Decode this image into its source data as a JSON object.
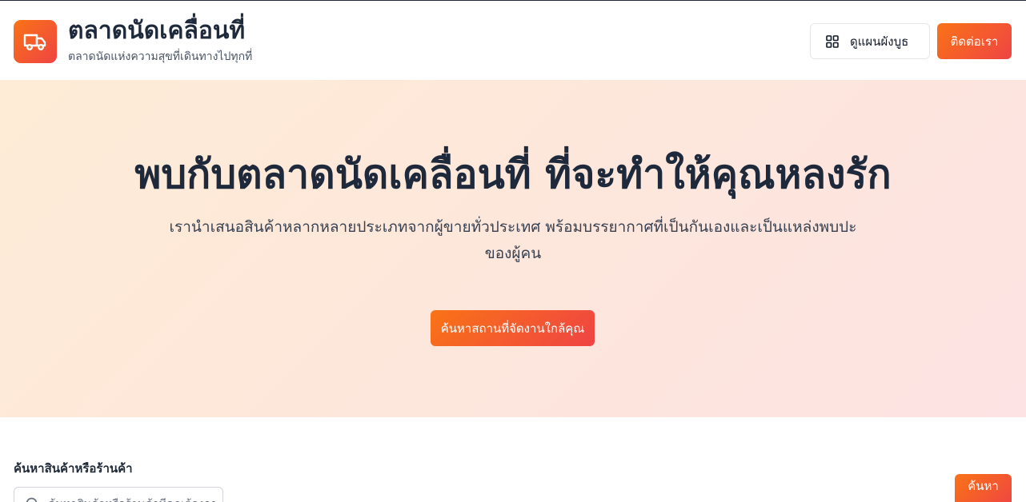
{
  "header": {
    "title": "ตลาดนัดเคลื่อนที่",
    "subtitle": "ตลาดนัดแห่งความสุขที่เดินทางไปทุกที่",
    "logo_icon": "truck-icon",
    "booth_map_label": "ดูแผนผังบูธ",
    "booth_map_icon": "grid-icon",
    "contact_label": "ติดต่อเรา"
  },
  "hero": {
    "title": "พบกับตลาดนัดเคลื่อนที่ ที่จะทำให้คุณหลงรัก",
    "description": "เรานำเสนอสินค้าหลากหลายประเภทจากผู้ขายทั่วประเทศ พร้อมบรรยากาศที่เป็นกันเองและเป็นแหล่งพบปะของผู้คน",
    "cta_label": "ค้นหาสถานที่จัดงานใกล้คุณ"
  },
  "search": {
    "label": "ค้นหาสินค้าหรือร้านค้า",
    "placeholder": "ค้นหาสินค้าหรือร้านค้าที่คุณต้องการ",
    "icon": "search-icon",
    "button_label": "ค้นหา"
  },
  "colors": {
    "accent_start": "#f97316",
    "accent_end": "#ef4444",
    "hero_bg": "#feecd6",
    "text_dark": "#1e293b"
  }
}
